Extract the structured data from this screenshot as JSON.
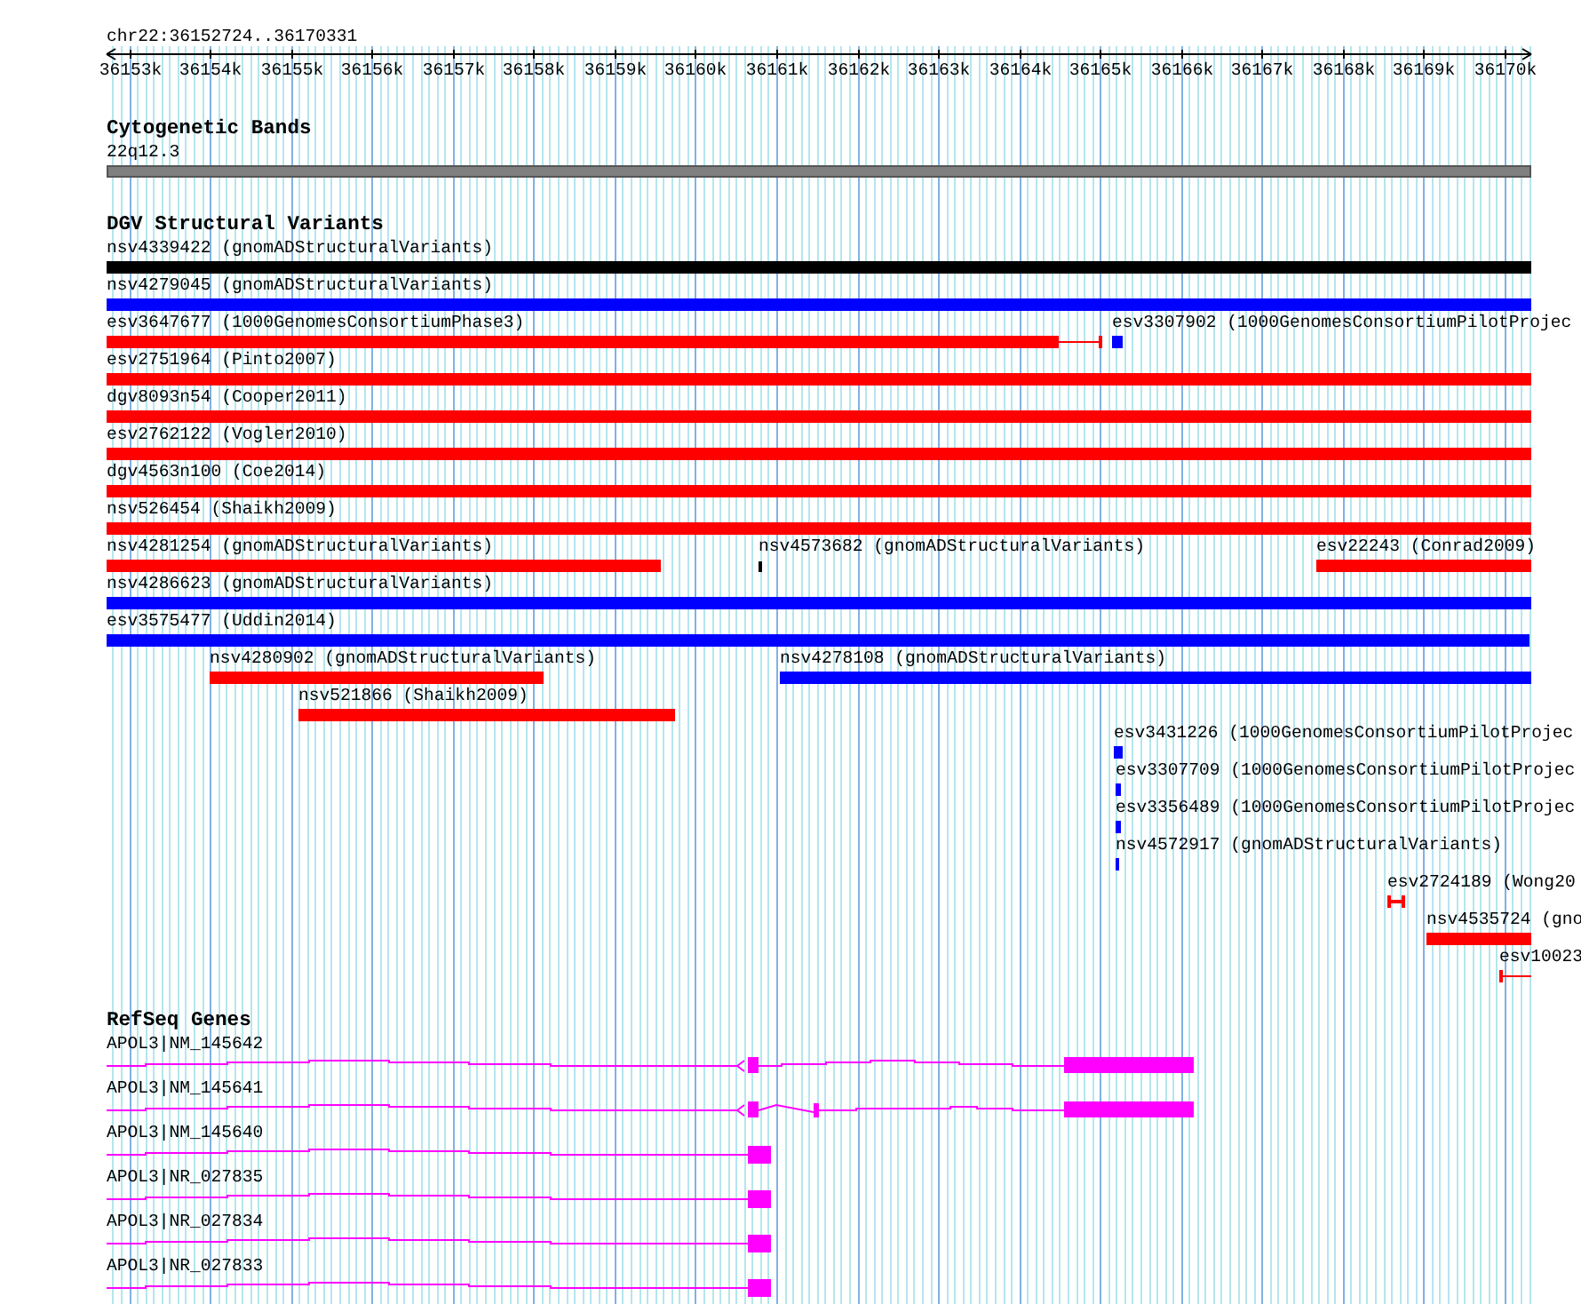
{
  "region": {
    "label": "chr22:36152724..36170331"
  },
  "ruler": {
    "ticks": [
      "36153k",
      "36154k",
      "36155k",
      "36156k",
      "36157k",
      "36158k",
      "36159k",
      "36160k",
      "36161k",
      "36162k",
      "36163k",
      "36164k",
      "36165k",
      "36166k",
      "36167k",
      "36168k",
      "36169k",
      "36170k"
    ]
  },
  "cytogenetic_bands": {
    "title": "Cytogenetic Bands",
    "band": {
      "label": "22q12.3"
    }
  },
  "dgv": {
    "title": "DGV Structural Variants",
    "rows": [
      [
        {
          "label": "nsv4339422 (gnomADStructuralVariants)",
          "color": "#000000"
        }
      ],
      [
        {
          "label": "nsv4279045 (gnomADStructuralVariants)",
          "color": "#0000ff"
        }
      ],
      [
        {
          "label": "esv3647677 (1000GenomesConsortiumPhase3)",
          "color": "#ff0000"
        },
        {
          "label": "esv3307902 (1000GenomesConsortiumPilotProjec",
          "color": "#0000ff"
        }
      ],
      [
        {
          "label": "esv2751964 (Pinto2007)",
          "color": "#ff0000"
        }
      ],
      [
        {
          "label": "dgv8093n54 (Cooper2011)",
          "color": "#ff0000"
        }
      ],
      [
        {
          "label": "esv2762122 (Vogler2010)",
          "color": "#ff0000"
        }
      ],
      [
        {
          "label": "dgv4563n100 (Coe2014)",
          "color": "#ff0000"
        }
      ],
      [
        {
          "label": "nsv526454 (Shaikh2009)",
          "color": "#ff0000"
        }
      ],
      [
        {
          "label": "nsv4281254 (gnomADStructuralVariants)",
          "color": "#ff0000"
        },
        {
          "label": "nsv4573682 (gnomADStructuralVariants)",
          "color": "#000000"
        },
        {
          "label": "esv22243 (Conrad2009)",
          "color": "#ff0000"
        }
      ],
      [
        {
          "label": "nsv4286623 (gnomADStructuralVariants)",
          "color": "#0000ff"
        }
      ],
      [
        {
          "label": "esv3575477 (Uddin2014)",
          "color": "#0000ff"
        }
      ],
      [
        {
          "label": "nsv4280902 (gnomADStructuralVariants)",
          "color": "#ff0000"
        },
        {
          "label": "nsv4278108 (gnomADStructuralVariants)",
          "color": "#0000ff"
        }
      ],
      [
        {
          "label": "nsv521866 (Shaikh2009)",
          "color": "#ff0000"
        }
      ],
      [
        {
          "label": "esv3431226 (1000GenomesConsortiumPilotProjec",
          "color": "#0000ff"
        }
      ],
      [
        {
          "label": "esv3307709 (1000GenomesConsortiumPilotProjec",
          "color": "#0000ff"
        }
      ],
      [
        {
          "label": "esv3356489 (1000GenomesConsortiumPilotProjec",
          "color": "#0000ff"
        }
      ],
      [
        {
          "label": "nsv4572917 (gnomADStructuralVariants)",
          "color": "#0000ff"
        }
      ],
      [
        {
          "label": "esv2724189 (Wong20",
          "color": "#ff0000"
        }
      ],
      [
        {
          "label": "nsv4535724 (gno",
          "color": "#ff0000"
        }
      ],
      [
        {
          "label": "esv10023",
          "color": "#ff0000"
        }
      ]
    ]
  },
  "refseq_genes": {
    "title": "RefSeq Genes",
    "transcripts": [
      {
        "label": "APOL3|NM_145642"
      },
      {
        "label": "APOL3|NM_145641"
      },
      {
        "label": "APOL3|NM_145640"
      },
      {
        "label": "APOL3|NR_027835"
      },
      {
        "label": "APOL3|NR_027834"
      },
      {
        "label": "APOL3|NR_027833"
      }
    ]
  }
}
